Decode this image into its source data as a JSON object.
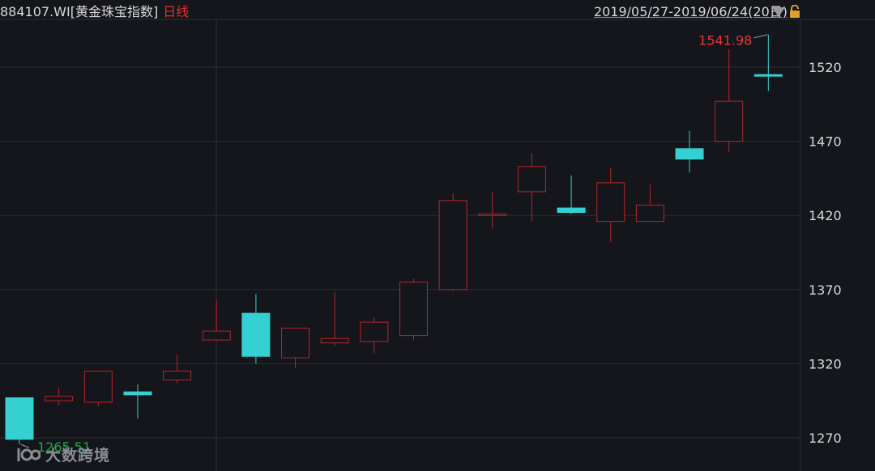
{
  "header": {
    "symbol": "884107.WI",
    "name": "[黄金珠宝指数]",
    "period": "日线",
    "range": "2019/05/27-2019/06/24(20日)"
  },
  "watermark": {
    "text": "大数跨境"
  },
  "colors": {
    "background": "#14161b",
    "grid": "#2b2e34",
    "up": "#b3262a",
    "down": "#35d0d2",
    "max_label": "#e8343a",
    "min_label": "#1fa84a",
    "axis_text": "#d8d8d8"
  },
  "chart_data": {
    "type": "candlestick",
    "ylim": [
      1260,
      1550
    ],
    "yticks": [
      1270,
      1320,
      1370,
      1420,
      1470,
      1520
    ],
    "grid": true,
    "max_label": "1541.98",
    "min_label": "1265.51",
    "candles": [
      {
        "open": 1297.0,
        "close": 1269.0,
        "high": 1297.0,
        "low": 1265.51
      },
      {
        "open": 1295.0,
        "close": 1298.0,
        "high": 1304.0,
        "low": 1292.0
      },
      {
        "open": 1294.0,
        "close": 1315.0,
        "high": 1315.0,
        "low": 1291.0
      },
      {
        "open": 1301.0,
        "close": 1299.0,
        "high": 1306.0,
        "low": 1283.0
      },
      {
        "open": 1309.0,
        "close": 1315.0,
        "high": 1326.0,
        "low": 1307.0
      },
      {
        "open": 1336.0,
        "close": 1342.0,
        "high": 1363.0,
        "low": 1335.0
      },
      {
        "open": 1354.0,
        "close": 1325.0,
        "high": 1367.0,
        "low": 1320.0
      },
      {
        "open": 1324.0,
        "close": 1344.0,
        "high": 1344.0,
        "low": 1317.0
      },
      {
        "open": 1334.0,
        "close": 1337.0,
        "high": 1368.0,
        "low": 1332.0
      },
      {
        "open": 1335.0,
        "close": 1348.0,
        "high": 1351.0,
        "low": 1327.0
      },
      {
        "open": 1339.0,
        "close": 1375.0,
        "high": 1377.0,
        "low": 1336.0
      },
      {
        "open": 1370.0,
        "close": 1430.0,
        "high": 1435.0,
        "low": 1369.0
      },
      {
        "open": 1420.0,
        "close": 1421.0,
        "high": 1436.0,
        "low": 1411.0
      },
      {
        "open": 1436.0,
        "close": 1453.0,
        "high": 1462.0,
        "low": 1416.0
      },
      {
        "open": 1425.0,
        "close": 1422.0,
        "high": 1447.0,
        "low": 1421.0
      },
      {
        "open": 1416.0,
        "close": 1442.0,
        "high": 1452.0,
        "low": 1402.0
      },
      {
        "open": 1416.0,
        "close": 1427.0,
        "high": 1441.0,
        "low": 1416.0
      },
      {
        "open": 1465.0,
        "close": 1458.0,
        "high": 1477.0,
        "low": 1449.0
      },
      {
        "open": 1470.0,
        "close": 1497.0,
        "high": 1532.0,
        "low": 1463.0
      },
      {
        "open": 1515.0,
        "close": 1514.0,
        "high": 1541.98,
        "low": 1504.0
      }
    ]
  }
}
